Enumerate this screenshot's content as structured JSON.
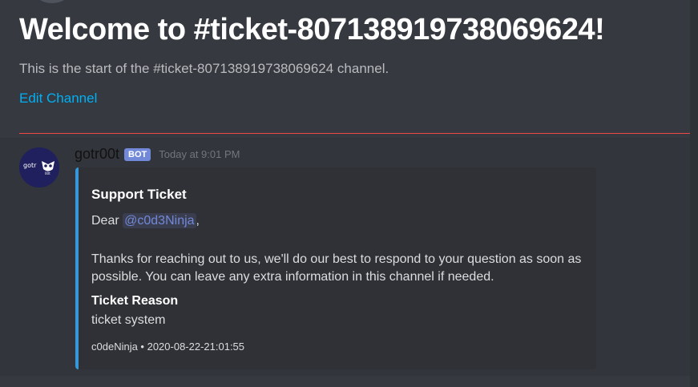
{
  "channel": {
    "welcome_title": "Welcome to #ticket-807138919738069624!",
    "welcome_subtitle": "This is the start of the #ticket-807138919738069624 channel.",
    "edit_channel_label": "Edit Channel"
  },
  "message": {
    "author": "gotr00t",
    "bot_tag": "BOT",
    "timestamp": "Today at 9:01 PM",
    "avatar_text": "gotr",
    "avatar_subtext": "00t",
    "embed": {
      "title": "Support Ticket",
      "greeting_prefix": "Dear",
      "mention": "@c0d3Ninja",
      "greeting_suffix": ",",
      "body": "Thanks for reaching out to us, we'll do our best to respond to your question as soon as possible. You can leave any extra information in this channel if needed.",
      "field_name": "Ticket Reason",
      "field_value": "ticket system",
      "footer": "c0deNinja • 2020-08-22-21:01:55"
    }
  },
  "colors": {
    "background": "#36393f",
    "message_background": "#32353b",
    "embed_background": "#2f3136",
    "embed_border": "#3498db",
    "link": "#00b0f4",
    "new_messages_divider": "#f04747",
    "bot_tag": "#7289da"
  }
}
